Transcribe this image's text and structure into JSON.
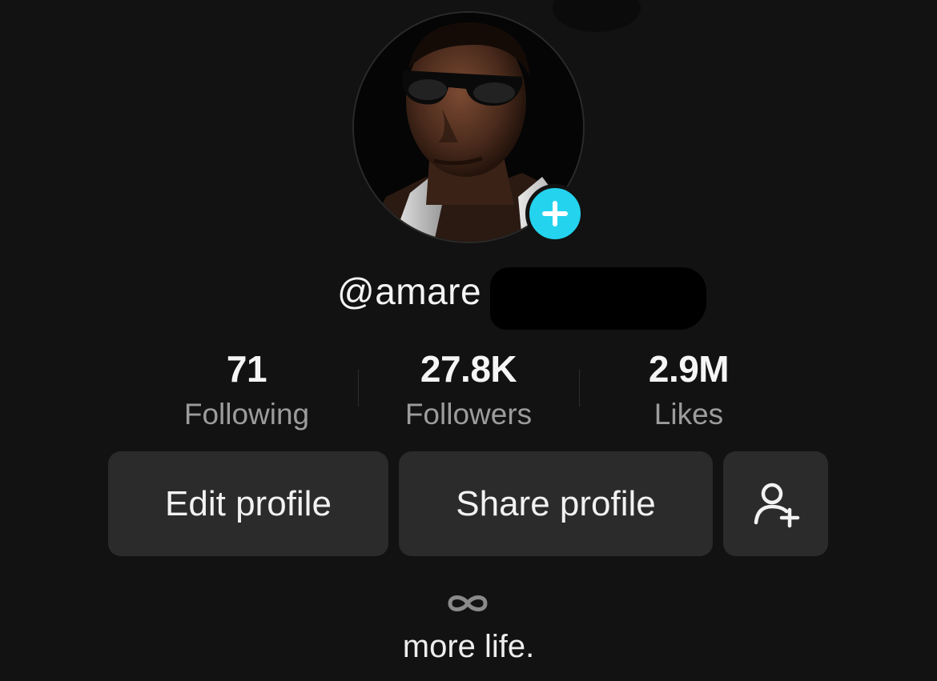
{
  "profile": {
    "username": "@amare",
    "avatar_add_icon": "plus-icon",
    "accent_color": "#24d3ee"
  },
  "stats": {
    "following": {
      "value": "71",
      "label": "Following"
    },
    "followers": {
      "value": "27.8K",
      "label": "Followers"
    },
    "likes": {
      "value": "2.9M",
      "label": "Likes"
    }
  },
  "actions": {
    "edit_label": "Edit profile",
    "share_label": "Share profile",
    "add_friend_icon": "add-person-icon"
  },
  "bio": {
    "icon": "infinity-icon",
    "text": "more life."
  }
}
